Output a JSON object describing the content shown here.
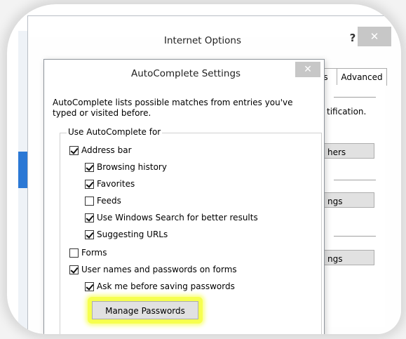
{
  "internet_options": {
    "title": "Internet Options",
    "help_label": "?",
    "close_label": "✕",
    "tabs": [
      {
        "label": "s"
      },
      {
        "label": "Advanced"
      }
    ],
    "partial_text": "tification.",
    "buttons": [
      "hers",
      "ngs",
      "ngs"
    ]
  },
  "autocomplete": {
    "title": "AutoComplete Settings",
    "close_label": "✕",
    "description": "AutoComplete lists possible matches from entries you've typed or visited before.",
    "group_label": "Use AutoComplete for",
    "checkboxes": [
      {
        "label": "Address bar",
        "checked": true
      },
      {
        "label": "Browsing history",
        "checked": true
      },
      {
        "label": "Favorites",
        "checked": true
      },
      {
        "label": "Feeds",
        "checked": false
      },
      {
        "label": "Use Windows Search for better results",
        "checked": true
      },
      {
        "label": "Suggesting URLs",
        "checked": true
      },
      {
        "label": "Forms",
        "checked": false
      },
      {
        "label": "User names and passwords on forms",
        "checked": true
      },
      {
        "label": "Ask me before saving passwords",
        "checked": true
      }
    ],
    "manage_passwords_label": "Manage Passwords",
    "highlight_color": "#f6ff3c"
  }
}
